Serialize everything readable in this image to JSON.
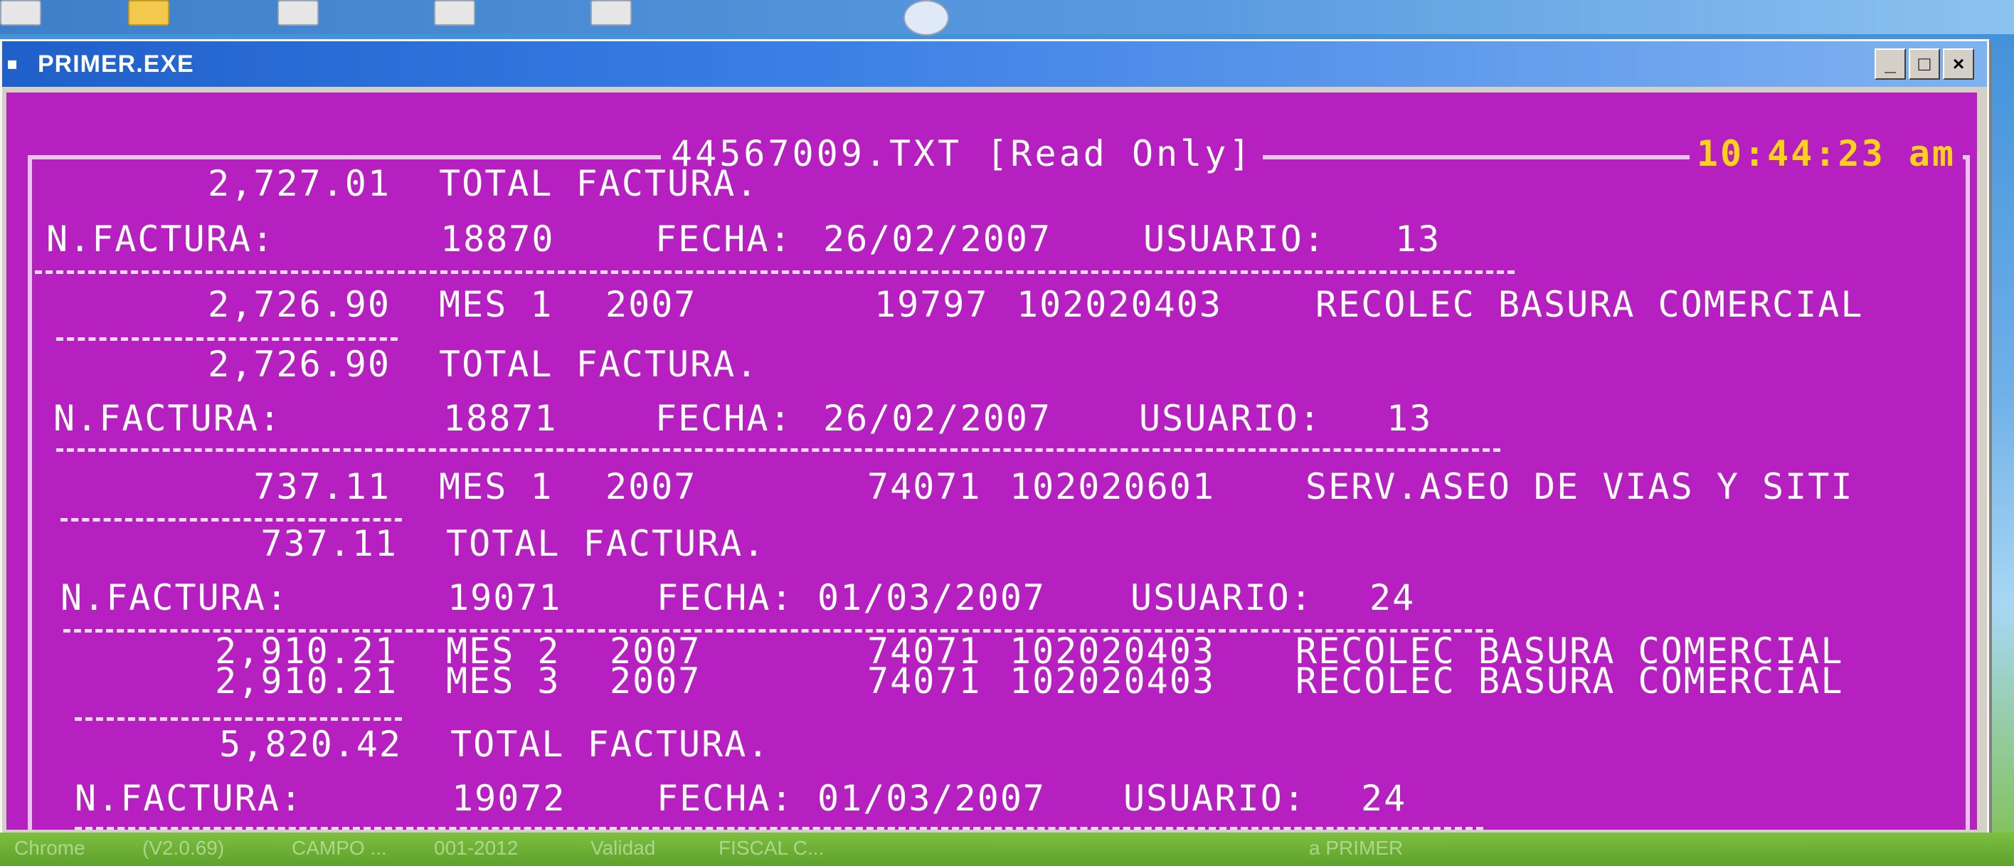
{
  "window": {
    "title": "PRIMER.EXE",
    "icon": "dos-app-icon",
    "buttons": {
      "minimize": "_",
      "maximize": "□",
      "close": "×"
    }
  },
  "console": {
    "file_label": "44567009.TXT [Read Only]",
    "clock": "10:44:23 am",
    "colors": {
      "background": "#b61fc0",
      "text": "#ffffff",
      "clock": "#ffd21a",
      "border": "#e9c5ee"
    }
  },
  "report": {
    "total_label": "TOTAL FACTURA.",
    "invoice_label": "N.FACTURA:",
    "date_label": "FECHA:",
    "user_label": "USUARIO:",
    "first_total": "2,727.01",
    "invoices": [
      {
        "number": "18870",
        "date": "26/02/2007",
        "user": "13",
        "lines": [
          {
            "amount": "2,726.90",
            "month": "MES 1",
            "year": "2007",
            "code": "19797",
            "account": "102020403",
            "desc": "RECOLEC BASURA COMERCIAL"
          }
        ],
        "total": "2,726.90"
      },
      {
        "number": "18871",
        "date": "26/02/2007",
        "user": "13",
        "lines": [
          {
            "amount": "737.11",
            "month": "MES 1",
            "year": "2007",
            "code": "74071",
            "account": "102020601",
            "desc": "SERV.ASEO DE VIAS Y SITI"
          }
        ],
        "total": "737.11"
      },
      {
        "number": "19071",
        "date": "01/03/2007",
        "user": "24",
        "lines": [
          {
            "amount": "2,910.21",
            "month": "MES 2",
            "year": "2007",
            "code": "74071",
            "account": "102020403",
            "desc": "RECOLEC BASURA COMERCIAL"
          },
          {
            "amount": "2,910.21",
            "month": "MES 3",
            "year": "2007",
            "code": "74071",
            "account": "102020403",
            "desc": "RECOLEC BASURA COMERCIAL"
          }
        ],
        "total": "5,820.42"
      },
      {
        "number": "19072",
        "date": "01/03/2007",
        "user": "24",
        "lines": []
      }
    ]
  },
  "taskbar": {
    "items": [
      "Chrome",
      "(V2.0.69)",
      "CAMPO ...",
      "001-2012",
      "Validad",
      "FISCAL C...",
      "a PRIMER"
    ]
  }
}
